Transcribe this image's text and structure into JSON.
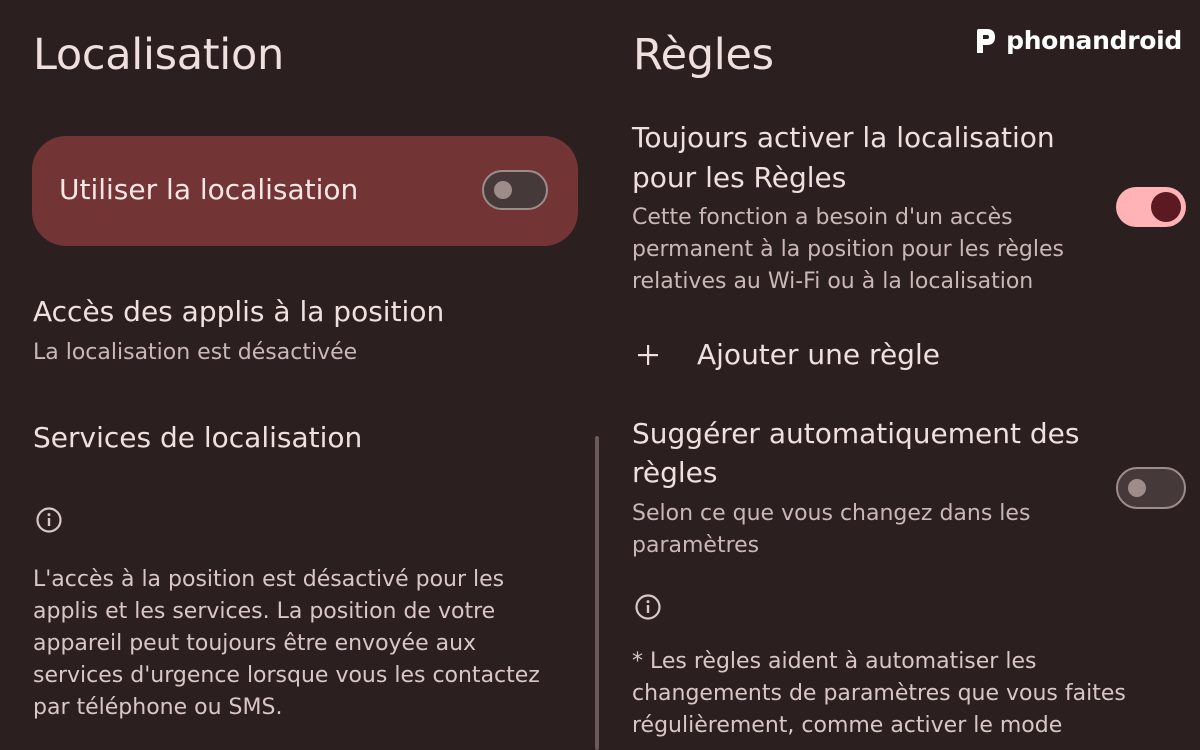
{
  "left": {
    "title": "Localisation",
    "master_toggle": {
      "label": "Utiliser la localisation",
      "state": "off"
    },
    "app_access": {
      "title": "Accès des applis à la position",
      "subtitle": "La localisation est désactivée"
    },
    "location_services": {
      "title": "Services de localisation"
    },
    "info_icon": "info-icon",
    "info_text": [
      "L'accès à la position est désactivé pour les",
      "applis et les services. La position de votre",
      "appareil peut toujours être envoyée aux",
      "services d'urgence lorsque vous les contactez",
      "par téléphone ou SMS."
    ]
  },
  "right": {
    "title": "Règles",
    "always_location": {
      "title_lines": [
        "Toujours activer la localisation",
        "pour les Règles"
      ],
      "description_lines": [
        "Cette fonction a besoin d'un accès",
        "permanent à la position pour les règles",
        "relatives au Wi-Fi ou à la localisation"
      ],
      "state": "on"
    },
    "add_rule": {
      "icon": "plus-icon",
      "label": "Ajouter une règle"
    },
    "suggest_rules": {
      "title_lines": [
        "Suggérer automatiquement des",
        "règles"
      ],
      "description_lines": [
        "Selon ce que vous changez dans les",
        "paramètres"
      ],
      "state": "off"
    },
    "info_icon": "info-icon",
    "info_text": [
      "* Les règles aident à automatiser les",
      "changements de paramètres que vous faites",
      "régulièrement, comme activer le mode"
    ]
  },
  "watermark": {
    "text": "phonandroid"
  },
  "colors": {
    "background": "#2b1f1f",
    "card": "#733435",
    "switch_on_track": "#ffb3b5",
    "switch_on_thumb": "#5b1a22",
    "switch_off_outline": "#9d8c8a"
  }
}
